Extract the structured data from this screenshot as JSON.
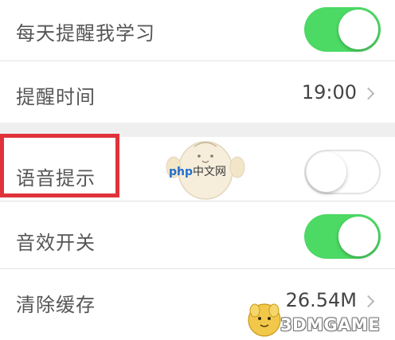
{
  "settings": {
    "items": [
      {
        "label": "每天提醒我学习",
        "type": "toggle",
        "state": "on"
      },
      {
        "label": "提醒时间",
        "type": "value",
        "value": "19:00"
      },
      {
        "label": "语音提示",
        "type": "toggle",
        "state": "off"
      },
      {
        "label": "音效开关",
        "type": "toggle",
        "state": "on"
      },
      {
        "label": "清除缓存",
        "type": "value",
        "value": "26.54M"
      }
    ]
  },
  "watermarks": {
    "php": {
      "text_php": "php",
      "text_cn": "中文网"
    },
    "game": {
      "text": "3DMGAME"
    }
  },
  "colors": {
    "toggle_on": "#4cd964",
    "highlight": "#e0323a"
  }
}
